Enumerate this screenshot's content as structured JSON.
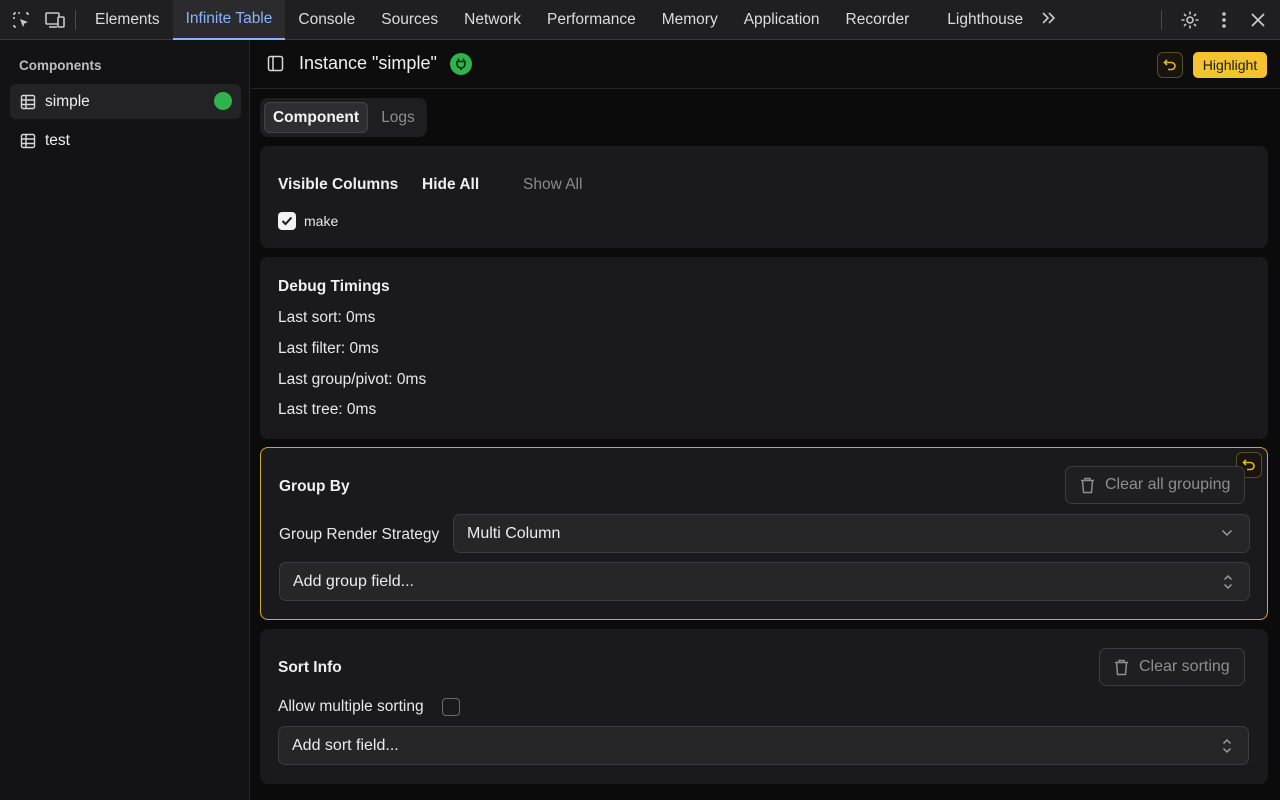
{
  "devtools": {
    "tabs": [
      {
        "label": "Elements"
      },
      {
        "label": "Infinite Table"
      },
      {
        "label": "Console"
      },
      {
        "label": "Sources"
      },
      {
        "label": "Network"
      },
      {
        "label": "Performance"
      },
      {
        "label": "Memory"
      },
      {
        "label": "Application"
      },
      {
        "label": "Recorder"
      },
      {
        "label": "Lighthouse"
      }
    ],
    "active_tab": "Infinite Table",
    "accent": "#8ab4f8"
  },
  "sidebar": {
    "heading": "Components",
    "items": [
      {
        "label": "simple",
        "status": "connected"
      },
      {
        "label": "test"
      }
    ],
    "status_color": "#2fb34a"
  },
  "header": {
    "title": "Instance \"simple\"",
    "highlight_label": "Highlight",
    "highlight_color": "#f4c430"
  },
  "tabs": {
    "component": "Component",
    "logs": "Logs"
  },
  "visible_columns": {
    "title": "Visible Columns",
    "hide_all": "Hide All",
    "show_all": "Show All",
    "columns": [
      {
        "label": "make",
        "checked": true
      }
    ]
  },
  "debug_timings": {
    "title": "Debug Timings",
    "lines": [
      "Last sort: 0ms",
      "Last filter: 0ms",
      "Last group/pivot: 0ms",
      "Last tree: 0ms"
    ]
  },
  "group_by": {
    "title": "Group By",
    "clear_label": "Clear all grouping",
    "strategy_label": "Group Render Strategy",
    "strategy_value": "Multi Column",
    "add_field_placeholder": "Add group field..."
  },
  "sort_info": {
    "title": "Sort Info",
    "clear_label": "Clear sorting",
    "allow_multiple_label": "Allow multiple sorting",
    "allow_multiple_checked": false,
    "add_field_placeholder": "Add sort field..."
  }
}
